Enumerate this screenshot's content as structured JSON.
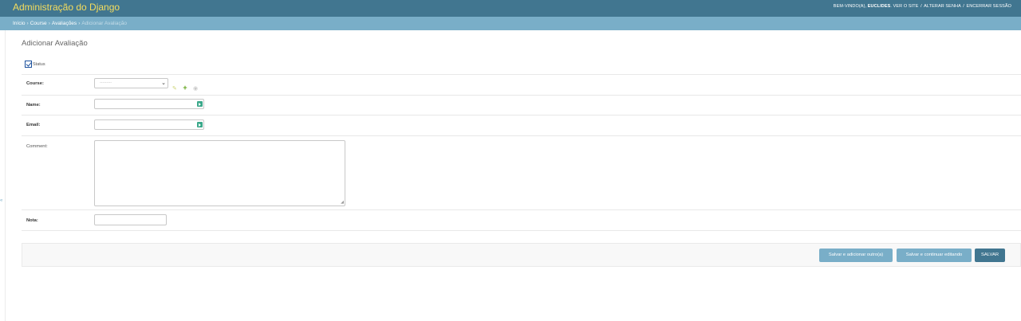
{
  "header": {
    "brand": "Administração do Django",
    "welcome": "BEM-VINDO(A),",
    "username": "EUCLIDES",
    "links": [
      "VER O SITE",
      "ALTERAR SENHA",
      "ENCERRAR SESSÃO"
    ],
    "separator": "/"
  },
  "breadcrumbs": {
    "items": [
      "Início",
      "Course",
      "Avaliações"
    ],
    "current": "Adicionar Avaliação",
    "separator": "›"
  },
  "page_title": "Adicionar Avaliação",
  "form": {
    "status": {
      "label": "Status",
      "checked": true
    },
    "course": {
      "label": "Course:",
      "selected": "---------"
    },
    "name": {
      "label": "Name:",
      "value": ""
    },
    "email": {
      "label": "Email:",
      "value": ""
    },
    "comment": {
      "label": "Comment:",
      "value": ""
    },
    "nota": {
      "label": "Nota:",
      "value": ""
    }
  },
  "buttons": {
    "save_add_another": "Salvar e adicionar outro(a)",
    "save_continue": "Salvar e continuar editando",
    "save": "SALVAR"
  },
  "colors": {
    "header_bg": "#417690",
    "brand_text": "#f5dd5d",
    "breadcrumbs_bg": "#79aec8",
    "button": "#79aec8",
    "default_button": "#417690"
  }
}
